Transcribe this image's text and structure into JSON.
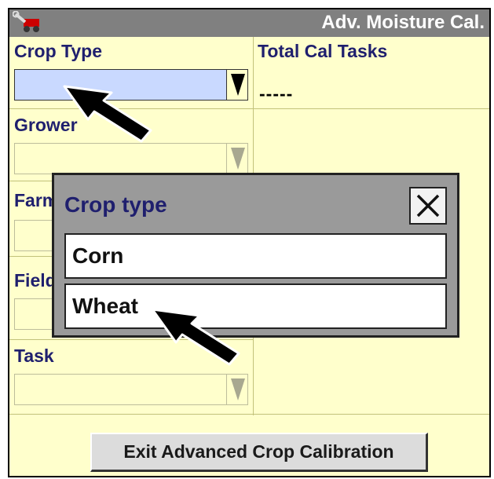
{
  "header": {
    "title": "Adv. Moisture Cal.",
    "icon": "wrench-cart-icon"
  },
  "fields": {
    "crop_type": {
      "label": "Crop Type",
      "value": "",
      "active": true
    },
    "grower": {
      "label": "Grower",
      "value": ""
    },
    "farm": {
      "label": "Farm",
      "value": ""
    },
    "field": {
      "label": "Field",
      "value": ""
    },
    "task": {
      "label": "Task",
      "value": ""
    }
  },
  "total_cal_tasks": {
    "label": "Total Cal Tasks",
    "value": "-----"
  },
  "exit_button": {
    "label": "Exit Advanced Crop Calibration"
  },
  "popup": {
    "title": "Crop type",
    "options": [
      {
        "label": "Corn"
      },
      {
        "label": "Wheat"
      }
    ],
    "close_icon": "close-x-icon"
  },
  "annotations": {
    "pointer_color": "#000000"
  }
}
